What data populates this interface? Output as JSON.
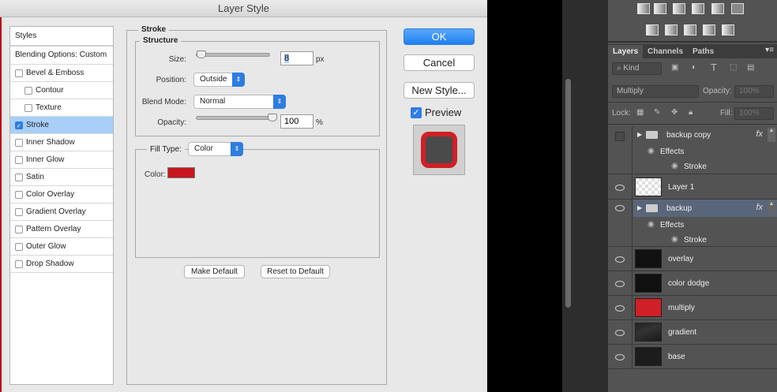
{
  "dialog": {
    "title": "Layer Style",
    "styles_header": "Styles",
    "blending": "Blending Options: Custom",
    "items": [
      {
        "label": "Bevel & Emboss",
        "checked": false,
        "indent": false
      },
      {
        "label": "Contour",
        "checked": false,
        "indent": true
      },
      {
        "label": "Texture",
        "checked": false,
        "indent": true
      },
      {
        "label": "Stroke",
        "checked": true,
        "indent": false
      },
      {
        "label": "Inner Shadow",
        "checked": false,
        "indent": false
      },
      {
        "label": "Inner Glow",
        "checked": false,
        "indent": false
      },
      {
        "label": "Satin",
        "checked": false,
        "indent": false
      },
      {
        "label": "Color Overlay",
        "checked": false,
        "indent": false
      },
      {
        "label": "Gradient Overlay",
        "checked": false,
        "indent": false
      },
      {
        "label": "Pattern Overlay",
        "checked": false,
        "indent": false
      },
      {
        "label": "Outer Glow",
        "checked": false,
        "indent": false
      },
      {
        "label": "Drop Shadow",
        "checked": false,
        "indent": false
      }
    ],
    "stroke": {
      "title": "Stroke",
      "structure": "Structure",
      "size_label": "Size:",
      "size": "8",
      "size_unit": "px",
      "position_label": "Position:",
      "position": "Outside",
      "blend_label": "Blend Mode:",
      "blend": "Normal",
      "opacity_label": "Opacity:",
      "opacity": "100",
      "opacity_unit": "%",
      "fill_type_label": "Fill Type:",
      "fill_type": "Color",
      "color_label": "Color:",
      "color": "#c8161d",
      "make_default": "Make Default",
      "reset_default": "Reset to Default"
    },
    "ok": "OK",
    "cancel": "Cancel",
    "new_style": "New Style...",
    "preview": "Preview"
  },
  "layers_panel": {
    "tabs": [
      "Layers",
      "Channels",
      "Paths"
    ],
    "kind": "Kind",
    "blend": "Multiply",
    "opacity_label": "Opacity:",
    "opacity": "100%",
    "lock_label": "Lock:",
    "fill_label": "Fill:",
    "fill": "100%",
    "effects": "Effects",
    "stroke": "Stroke",
    "layers": [
      "backup copy",
      "Layer 1",
      "backup",
      "overlay",
      "color dodge",
      "multiply",
      "gradient",
      "base"
    ]
  }
}
